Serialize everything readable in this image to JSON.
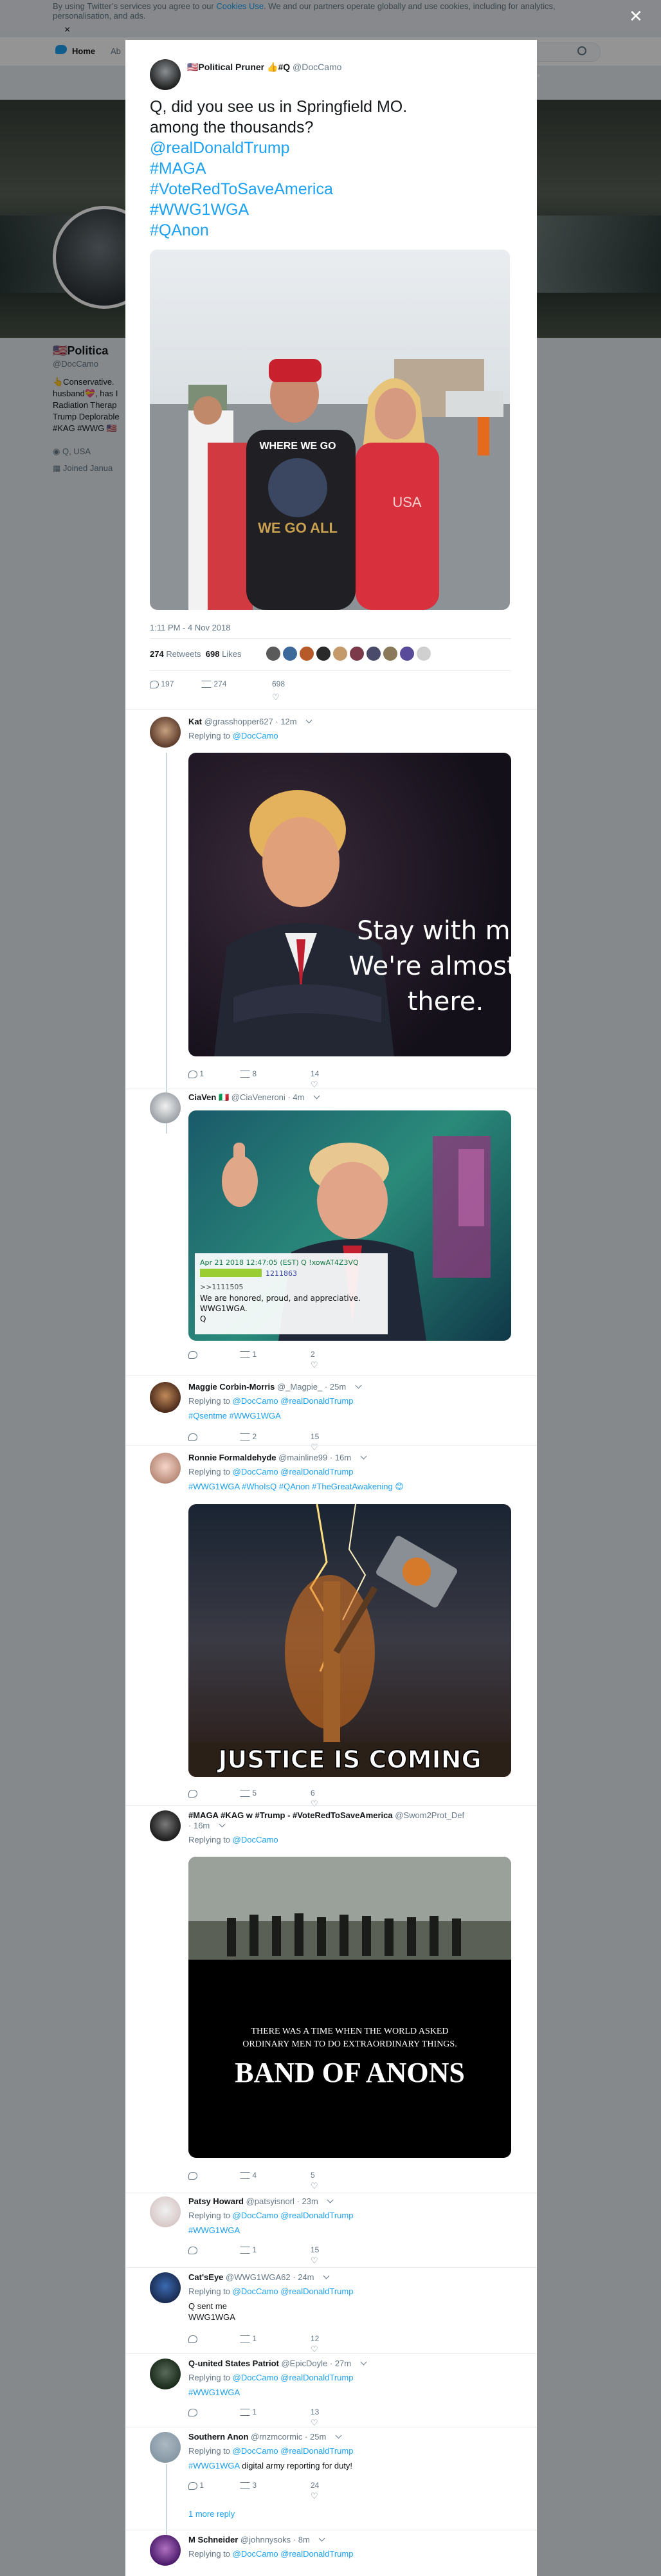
{
  "cookie_bar": {
    "text_before": "By using Twitter’s services you agree to our ",
    "link": "Cookies Use",
    "text_after": ". We and our partners operate globally and use cookies, including for analytics, personalisation, and ads.",
    "close": "×"
  },
  "nav": {
    "home": "Home",
    "more": "Ab",
    "dropdown": "li ▾"
  },
  "profile": {
    "name": "🇺🇸Politica",
    "handle": "@DocCamo",
    "bio": "👆Conservative. husband💝, has I Radiation Therap Trump Deplorable #KAG #WWG 🇺🇸",
    "location": "Q, USA",
    "joined": "Joined Janua"
  },
  "modal_close": "✕",
  "tweet": {
    "name": "🇺🇸Political Pruner 👍#Q",
    "handle": "@DocCamo",
    "lines": [
      "Q, did you see us in Springfield MO.",
      "among the thousands?"
    ],
    "tags": [
      "@realDonaldTrump",
      "#MAGA",
      "#VoteRedToSaveAmerica",
      "#WWG1WGA",
      "#QAnon"
    ],
    "time": "1:11 PM - 4 Nov 2018",
    "retweets_count": "274",
    "retweets_label": "Retweets",
    "likes_count": "698",
    "likes_label": "Likes",
    "actions": {
      "reply": "197",
      "retweet": "274",
      "like": "698"
    },
    "photo": {
      "cap_top": "WHERE WE GO",
      "cap_bottom": "WE GO ALL",
      "shirt_right": "USA"
    }
  },
  "replies": [
    {
      "name": "Kat",
      "handle": "@grasshopper627",
      "time": "12m",
      "replying_to": "Replying to",
      "mentions": [
        "@DocCamo"
      ],
      "text": "",
      "hashtags": "",
      "image": {
        "line1": "Stay with me.",
        "line2": "We're almost",
        "line3": "there."
      },
      "reply": "1",
      "retweet": "8",
      "like": "14"
    },
    {
      "name": "CiaVen 🇮🇹",
      "handle": "@CiaVeneroni",
      "time": "4m",
      "replying_to": "",
      "mentions": [],
      "text": "",
      "hashtags": "",
      "image": {
        "post_header": "Apr 21 2018 12:47:05 (EST) Q !xowAT4Z3VQ",
        "post_id": "1211863",
        "ref": ">>1111505",
        "line1": "We are honored, proud, and appreciative.",
        "line2": "WWG1WGA.",
        "line3": "Q"
      },
      "reply": "",
      "retweet": "1",
      "like": "2"
    },
    {
      "name": "Maggie Corbin-Morris",
      "handle": "@_Magpie_",
      "time": "25m",
      "replying_to": "Replying to",
      "mentions": [
        "@DocCamo",
        "@realDonaldTrump"
      ],
      "text": "",
      "hashtags": "#Qsentme #WWG1WGA",
      "reply": "",
      "retweet": "2",
      "like": "15"
    },
    {
      "name": "Ronnie Formaldehyde",
      "handle": "@mainline99",
      "time": "16m",
      "replying_to": "Replying to",
      "mentions": [
        "@DocCamo",
        "@realDonaldTrump"
      ],
      "text": "",
      "hashtags": "#WWG1WGA #WhoIsQ #QAnon #TheGreatAwakening 😊",
      "image": {
        "line1": "JUSTICE IS COMING"
      },
      "reply": "",
      "retweet": "5",
      "like": "6"
    },
    {
      "name": "#MAGA #KAG w #Trump - #VoteRedToSaveAmerica",
      "handle": "@Swom2Prot_Def",
      "time": "16m",
      "replying_to": "Replying to",
      "mentions": [
        "@DocCamo"
      ],
      "text": "",
      "hashtags": "",
      "image": {
        "line1": "THERE WAS A TIME WHEN THE WORLD ASKED",
        "line2": "ORDINARY MEN TO DO EXTRAORDINARY THINGS.",
        "line3": "BAND OF ANONS"
      },
      "reply": "",
      "retweet": "4",
      "like": "5"
    },
    {
      "name": "Patsy Howard",
      "handle": "@patsyisnorl",
      "time": "23m",
      "replying_to": "Replying to",
      "mentions": [
        "@DocCamo",
        "@realDonaldTrump"
      ],
      "text": "",
      "hashtags": "#WWG1WGA",
      "reply": "",
      "retweet": "1",
      "like": "15"
    },
    {
      "name": "Cat'sEye",
      "handle": "@WWG1WGA62",
      "time": "24m",
      "replying_to": "Replying to",
      "mentions": [
        "@DocCamo",
        "@realDonaldTrump"
      ],
      "text": "Q sent me",
      "hashtags": "WWG1WGA",
      "reply": "",
      "retweet": "1",
      "like": "12"
    },
    {
      "name": "Q-united States Patriot",
      "handle": "@EpicDoyle",
      "time": "27m",
      "replying_to": "Replying to",
      "mentions": [
        "@DocCamo",
        "@realDonaldTrump"
      ],
      "text": "",
      "hashtags": "#WWG1WGA",
      "reply": "",
      "retweet": "1",
      "like": "13"
    },
    {
      "name": "Southern Anon",
      "handle": "@rnzmcormic",
      "time": "25m",
      "replying_to": "Replying to",
      "mentions": [
        "@DocCamo",
        "@realDonaldTrump"
      ],
      "text": "digital army reporting for duty!",
      "hashtags": "#WWG1WGA",
      "reply": "1",
      "retweet": "3",
      "like": "24",
      "more": "1 more reply"
    },
    {
      "name": "M Schneider",
      "handle": "@johnnysoks",
      "time": "8m",
      "replying_to": "Replying to",
      "mentions": [
        "@DocCamo",
        "@realDonaldTrump"
      ],
      "text": "",
      "hashtags": ""
    }
  ]
}
